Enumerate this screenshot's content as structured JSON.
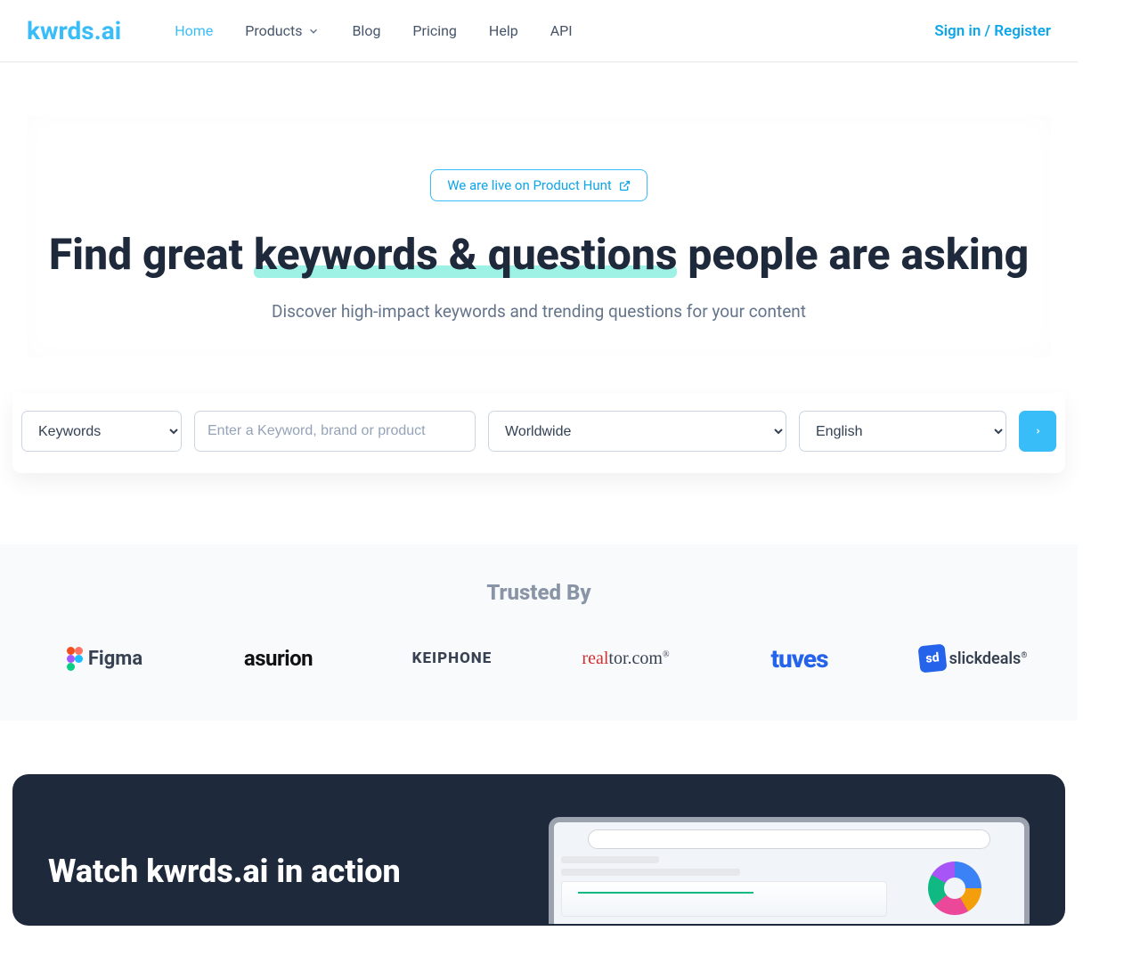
{
  "brand": "kwrds.ai",
  "nav": {
    "items": [
      {
        "label": "Home",
        "active": true,
        "hasDropdown": false
      },
      {
        "label": "Products",
        "active": false,
        "hasDropdown": true
      },
      {
        "label": "Blog",
        "active": false,
        "hasDropdown": false
      },
      {
        "label": "Pricing",
        "active": false,
        "hasDropdown": false
      },
      {
        "label": "Help",
        "active": false,
        "hasDropdown": false
      },
      {
        "label": "API",
        "active": false,
        "hasDropdown": false
      }
    ],
    "signin": "Sign in / Register"
  },
  "hero": {
    "badge": "We are live on Product Hunt",
    "title_pre": "Find great ",
    "title_hl": "keywords & questions",
    "title_post": " people are asking",
    "subtitle": "Discover high-impact keywords and trending questions for your content"
  },
  "search": {
    "type_selected": "Keywords",
    "keyword_placeholder": "Enter a Keyword, brand or product",
    "region_selected": "Worldwide",
    "lang_selected": "English"
  },
  "trusted": {
    "title": "Trusted By",
    "logos": [
      "Figma",
      "asurion",
      "KEIPHONE",
      "realtor.com",
      "tuves",
      "slickdeals"
    ]
  },
  "action": {
    "title": "Watch kwrds.ai in action"
  }
}
